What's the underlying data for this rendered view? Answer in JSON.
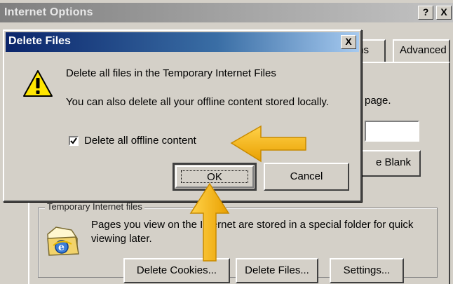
{
  "background_window": {
    "title": "Internet Options",
    "help_button": "?",
    "close_button": "X",
    "tabs": [
      {
        "label": "ms"
      },
      {
        "label": "Advanced"
      }
    ],
    "home_page_text": "page.",
    "use_blank_button": "e Blank",
    "temporary_files": {
      "group_label": "Temporary Internet files",
      "description": "Pages you view on the Internet are stored in a special folder for quick viewing later.",
      "buttons": {
        "delete_cookies": "Delete Cookies...",
        "delete_files": "Delete Files...",
        "settings": "Settings..."
      }
    }
  },
  "dialog": {
    "title": "Delete Files",
    "close_button": "X",
    "message": "Delete all files in the Temporary Internet Files",
    "submessage": "You can also delete all your offline content stored locally.",
    "checkbox": {
      "label": "Delete all offline content",
      "checked": true
    },
    "ok_label": "OK",
    "cancel_label": "Cancel"
  },
  "colors": {
    "dialog_title_start": "#0a246a",
    "dialog_title_end": "#a6caf0",
    "window_face": "#d4d0c8",
    "arrow": "#f5b716"
  }
}
